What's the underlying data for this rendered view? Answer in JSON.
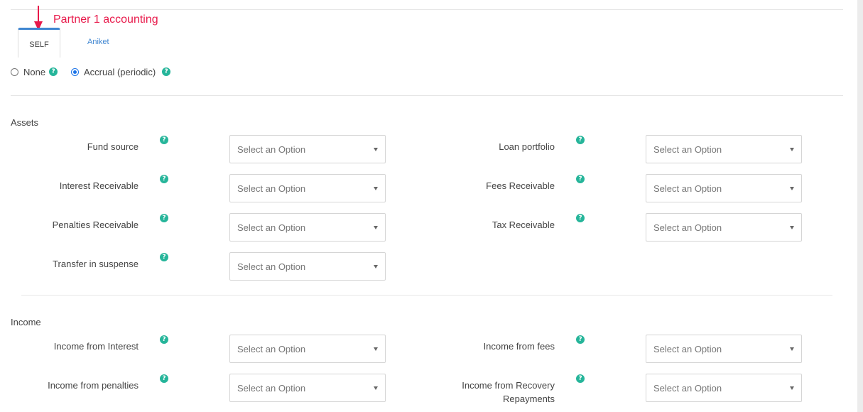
{
  "annotation": {
    "text": "Partner 1 accounting"
  },
  "tabs": [
    {
      "label": "SELF",
      "active": true
    },
    {
      "label": "Aniket",
      "active": false
    }
  ],
  "accounting_mode": {
    "options": [
      {
        "label": "None",
        "selected": false
      },
      {
        "label": "Accrual (periodic)",
        "selected": true
      }
    ],
    "help_icon": "question-circle-icon"
  },
  "select_placeholder": "Select an Option",
  "sections": {
    "assets": {
      "title": "Assets",
      "fields": {
        "fund_source": "Fund source",
        "loan_portfolio": "Loan portfolio",
        "interest_receivable": "Interest Receivable",
        "fees_receivable": "Fees Receivable",
        "penalties_receivable": "Penalties Receivable",
        "tax_receivable": "Tax Receivable",
        "transfer_in_suspense": "Transfer in suspense"
      }
    },
    "income": {
      "title": "Income",
      "fields": {
        "income_from_interest": "Income from Interest",
        "income_from_fees": "Income from fees",
        "income_from_penalties": "Income from penalties",
        "income_from_recovery": "Income from Recovery Repayments"
      }
    }
  },
  "colors": {
    "accent": "#3f86d1",
    "help": "#26b59a",
    "annotation": "#e8194a"
  }
}
